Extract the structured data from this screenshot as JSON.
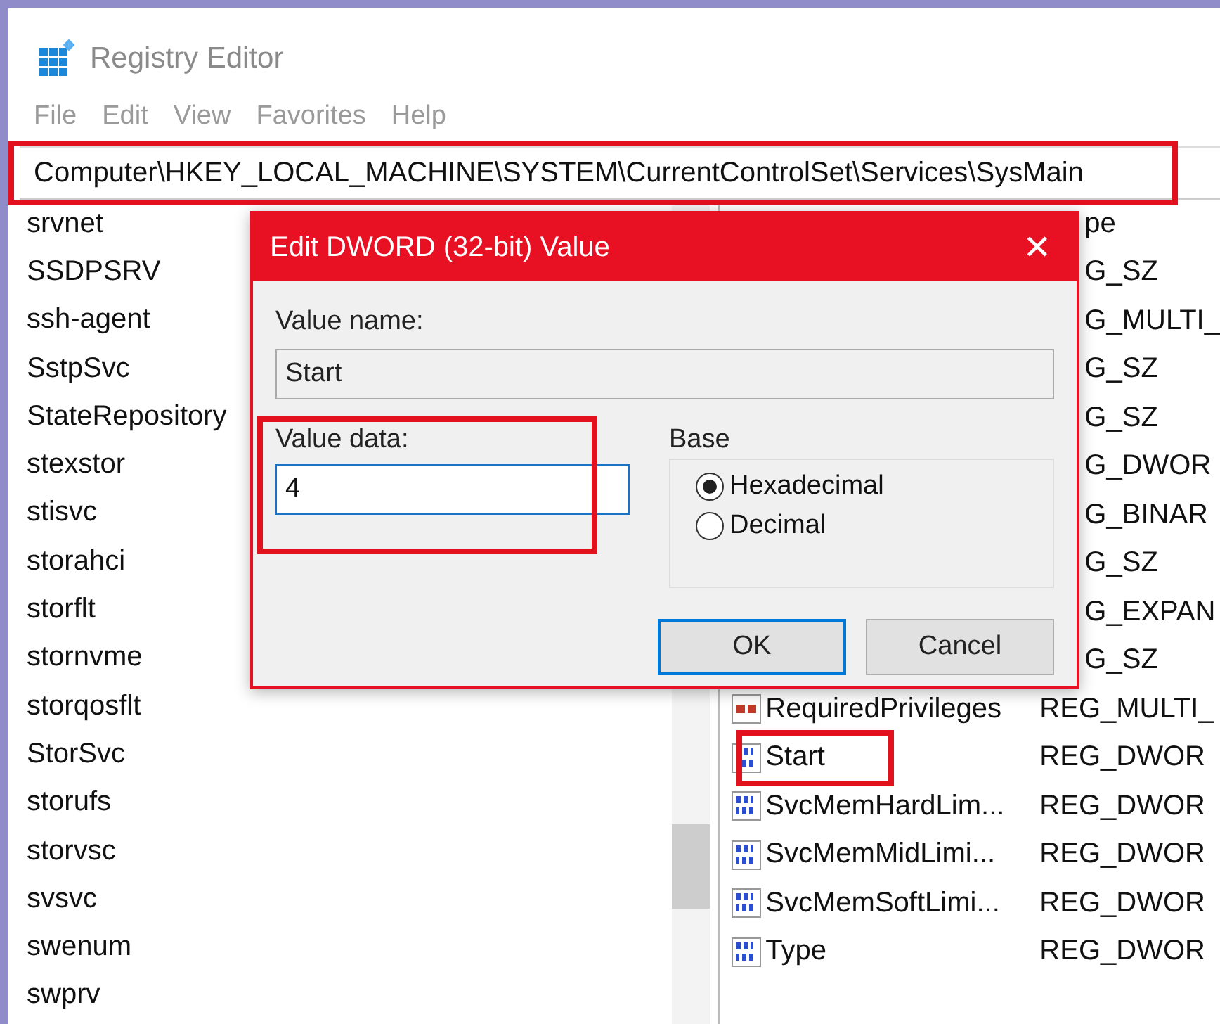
{
  "window": {
    "title": "Registry Editor"
  },
  "menu": [
    "File",
    "Edit",
    "View",
    "Favorites",
    "Help"
  ],
  "address": "Computer\\HKEY_LOCAL_MACHINE\\SYSTEM\\CurrentControlSet\\Services\\SysMain",
  "tree": [
    "srvnet",
    "SSDPSRV",
    "ssh-agent",
    "SstpSvc",
    "StateRepository",
    "stexstor",
    "stisvc",
    "storahci",
    "storflt",
    "stornvme",
    "storqosflt",
    "StorSvc",
    "storufs",
    "storvsc",
    "svsvc",
    "swenum",
    "swprv"
  ],
  "values": {
    "column_header": "pe",
    "rows": [
      {
        "type": "G_SZ"
      },
      {
        "type": "G_MULTI_"
      },
      {
        "type": "G_SZ"
      },
      {
        "type": "G_SZ"
      },
      {
        "type": "G_DWOR"
      },
      {
        "type": "G_BINAR"
      },
      {
        "type": "G_SZ"
      },
      {
        "type": "G_EXPAN"
      },
      {
        "type": "G_SZ"
      },
      {
        "kind": "string",
        "name": "RequiredPrivileges",
        "type": "REG_MULTI_"
      },
      {
        "kind": "binary",
        "name": "Start",
        "type": "REG_DWOR"
      },
      {
        "kind": "binary",
        "name": "SvcMemHardLim...",
        "type": "REG_DWOR"
      },
      {
        "kind": "binary",
        "name": "SvcMemMidLimi...",
        "type": "REG_DWOR"
      },
      {
        "kind": "binary",
        "name": "SvcMemSoftLimi...",
        "type": "REG_DWOR"
      },
      {
        "kind": "binary",
        "name": "Type",
        "type": "REG_DWOR"
      }
    ]
  },
  "dialog": {
    "title": "Edit DWORD (32-bit) Value",
    "close": "✕",
    "value_name_label": "Value name:",
    "value_name": "Start",
    "value_data_label": "Value data:",
    "value_data": "4",
    "base": {
      "label": "Base",
      "options": [
        {
          "label": "Hexadecimal",
          "selected": true
        },
        {
          "label": "Decimal",
          "selected": false
        }
      ]
    },
    "buttons": [
      {
        "label": "OK",
        "default": true
      },
      {
        "label": "Cancel",
        "default": false
      }
    ]
  }
}
